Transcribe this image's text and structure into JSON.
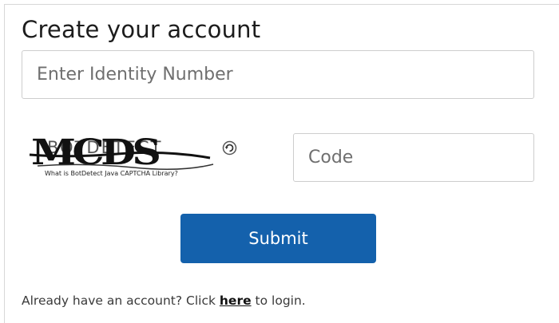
{
  "form": {
    "title": "Create your account",
    "identity_placeholder": "Enter Identity Number",
    "code_placeholder": "Code",
    "submit_label": "Submit"
  },
  "captcha": {
    "text": "MCDS",
    "background_text": "BOTDETECT",
    "caption": "What is BotDetect Java CAPTCHA Library?",
    "reload_icon": "reload-icon"
  },
  "footer": {
    "prefix": "Already have an account? Click ",
    "link": "here",
    "suffix": " to login."
  },
  "colors": {
    "primary": "#1461ac",
    "border": "#cdcdcd",
    "text": "#1c1c1c"
  }
}
